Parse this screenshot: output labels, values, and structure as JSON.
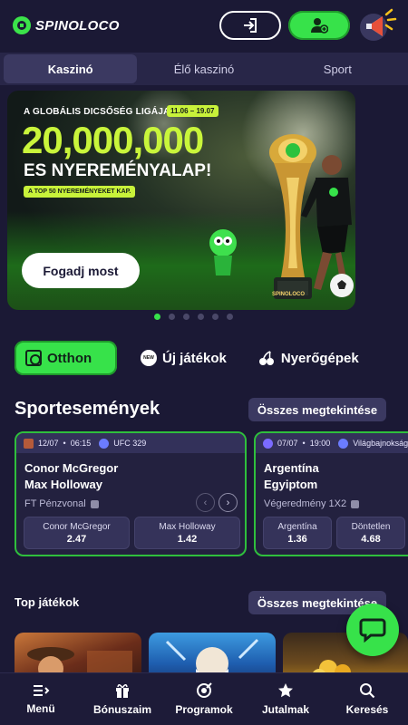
{
  "header": {
    "logo_text": "SPINOLOCO"
  },
  "tabs": [
    {
      "label": "Kaszinó",
      "active": true
    },
    {
      "label": "Élő kaszinó",
      "active": false
    },
    {
      "label": "Sport",
      "active": false
    }
  ],
  "banner": {
    "subtitle": "A GLOBÁLIS DICSŐSÉG LIGÁJA",
    "dates": "11.06 – 19.07",
    "amount": "20,000,000",
    "line2": "ES NYEREMÉNYALAP!",
    "tag": "A TOP 50 NYEREMÉNYEKET KAP.",
    "trophy_text": "SPINOLOCO",
    "cta": "Fogadj most",
    "slide_count": 6,
    "active_slide": 1
  },
  "categories": [
    {
      "label": "Otthon",
      "icon": "home-icon",
      "active": true
    },
    {
      "label": "Új játékok",
      "icon": "new-badge-icon",
      "badge": "NEW",
      "active": false
    },
    {
      "label": "Nyerőgépek",
      "icon": "cherry-icon",
      "active": false
    }
  ],
  "sports_section": {
    "title": "Sportesemények",
    "see_all": "Összes megtekintése"
  },
  "events": [
    {
      "date": "12/07",
      "time": "06:15",
      "league": "UFC 329",
      "team1": "Conor McGregor",
      "team2": "Max Holloway",
      "market": "FT Pénzvonal",
      "odds": [
        {
          "name": "Conor McGregor",
          "value": "2.47"
        },
        {
          "name": "Max Holloway",
          "value": "1.42"
        }
      ]
    },
    {
      "date": "07/07",
      "time": "19:00",
      "league": "Világbajnokság",
      "team1": "Argentína",
      "team2": "Egyiptom",
      "market": "Végeredmény 1X2",
      "odds": [
        {
          "name": "Argentína",
          "value": "1.36"
        },
        {
          "name": "Döntetlen",
          "value": "4.68"
        }
      ]
    }
  ],
  "games_section": {
    "title": "Top játékok",
    "see_all": "Összes megtekintése"
  },
  "bottom_nav": [
    {
      "label": "Menü",
      "icon": "menu-icon"
    },
    {
      "label": "Bónuszaim",
      "icon": "gift-icon"
    },
    {
      "label": "Programok",
      "icon": "target-icon"
    },
    {
      "label": "Jutalmak",
      "icon": "star-icon"
    },
    {
      "label": "Keresés",
      "icon": "search-icon"
    }
  ],
  "colors": {
    "accent": "#37e24a",
    "background": "#1b1935",
    "banner_text": "#c9f53b"
  }
}
